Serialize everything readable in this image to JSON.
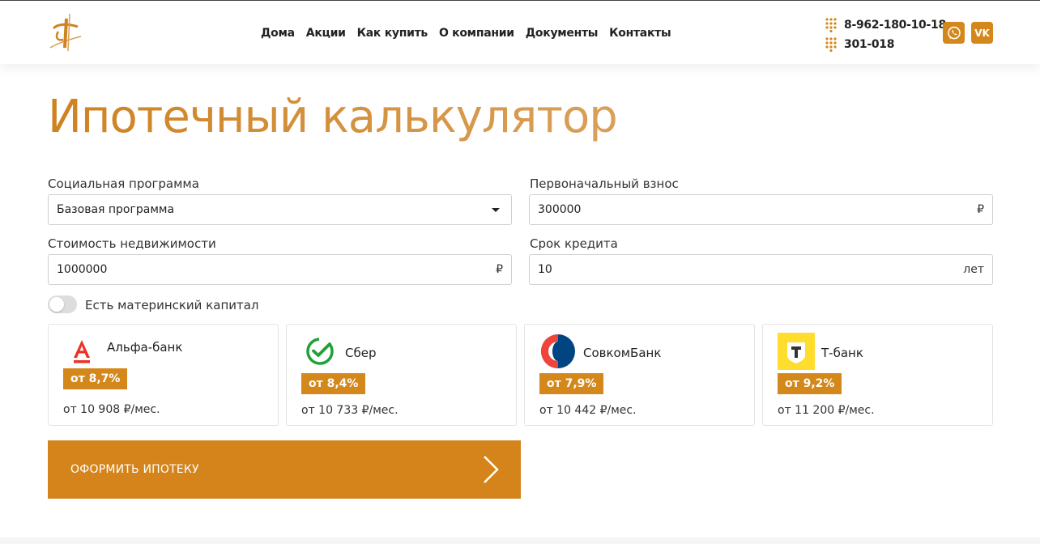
{
  "nav": {
    "items": [
      "Дома",
      "Акции",
      "Как купить",
      "О компании",
      "Документы",
      "Контакты"
    ]
  },
  "contacts": {
    "phone1": "8-962-180-10-18",
    "phone2": "301-018",
    "whatsapp_icon": "whatsapp-icon",
    "vk_icon": "vk-icon",
    "vk_text": "VK"
  },
  "title": "Ипотечный калькулятор",
  "form": {
    "program_label": "Социальная программа",
    "program_value": "Базовая программа",
    "down_payment_label": "Первоначальный взнос",
    "down_payment_value": "300000",
    "down_payment_suffix": "₽",
    "price_label": "Стоимость недвижимости",
    "price_value": "1000000",
    "price_suffix": "₽",
    "term_label": "Срок кредита",
    "term_value": "10",
    "term_suffix": "лет",
    "maternity_label": "Есть материнский капитал",
    "maternity_enabled": false
  },
  "banks": [
    {
      "name": "Альфа-банк",
      "rate": "от 8,7%",
      "monthly": "от 10 908 ₽/мес.",
      "color": "#ef3124"
    },
    {
      "name": "Сбер",
      "rate": "от 8,4%",
      "monthly": "от 10 733 ₽/мес.",
      "color": "#21a038"
    },
    {
      "name": "СовкомБанк",
      "rate": "от 7,9%",
      "monthly": "от 10 442 ₽/мес.",
      "color": "#004481"
    },
    {
      "name": "Т-банк",
      "rate": "от 9,2%",
      "monthly": "от 11 200 ₽/мес.",
      "color": "#ffdd2d"
    }
  ],
  "cta": {
    "label": "ОФОРМИТЬ ИПОТЕКУ"
  },
  "colors": {
    "accent": "#d4871a",
    "title_start": "#cf8220",
    "title_end": "#d9a05a"
  }
}
